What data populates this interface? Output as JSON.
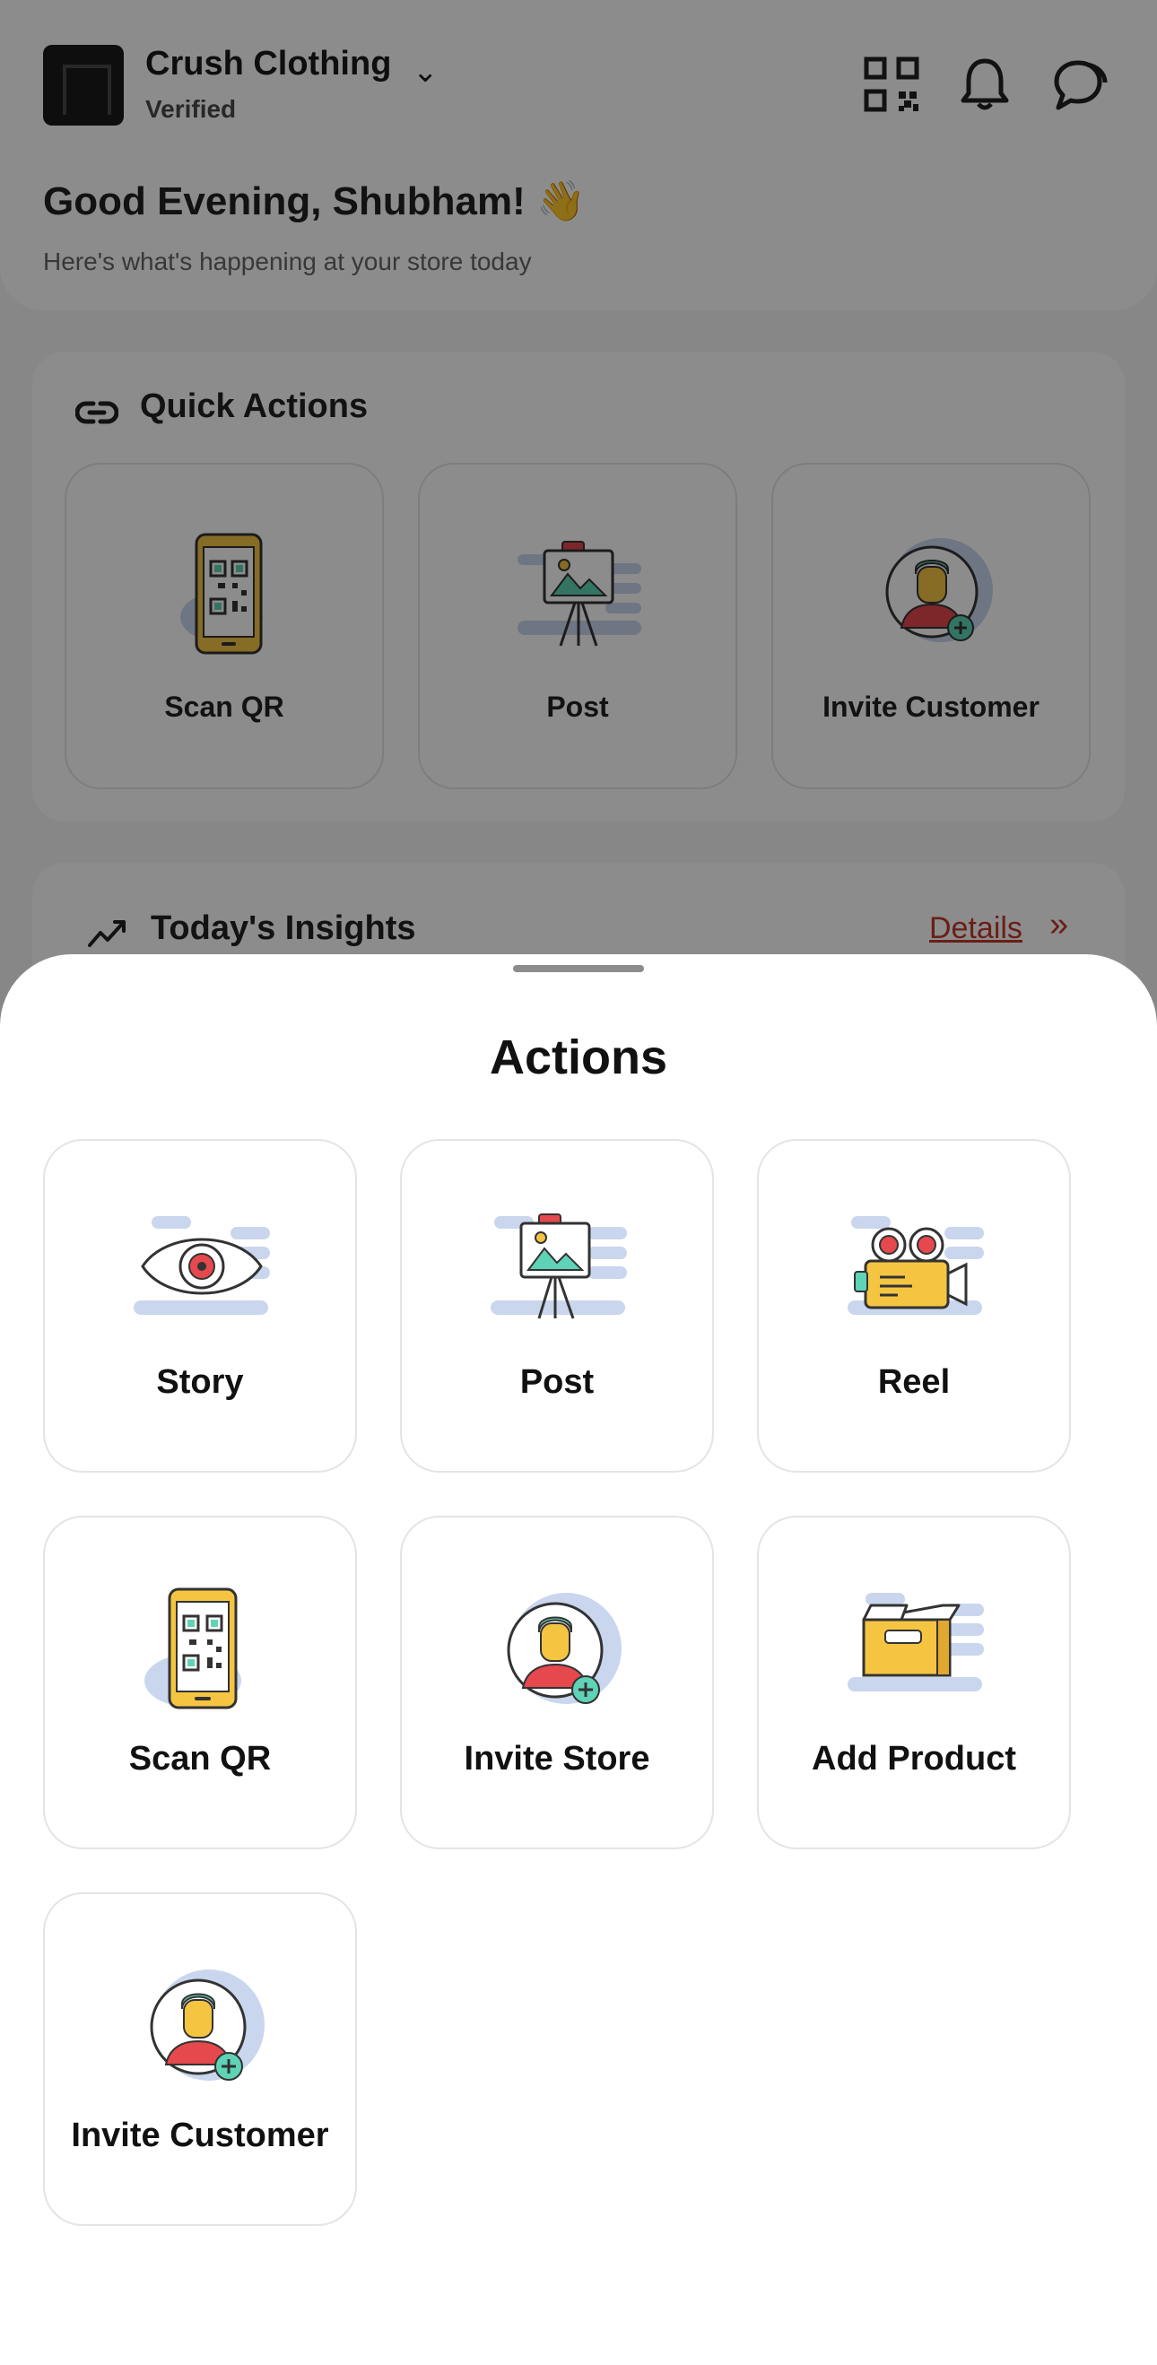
{
  "header": {
    "store_name": "Crush Clothing",
    "verified": "Verified",
    "greeting": "Good Evening, Shubham! 👋",
    "subtitle": "Here's what's happening at your store today",
    "icons": [
      "qr-icon",
      "bell-icon",
      "chat-icon",
      "chevron-down-icon"
    ]
  },
  "quick_actions": {
    "title": "Quick Actions",
    "items": [
      {
        "label": "Scan QR",
        "icon": "phone-qr-icon"
      },
      {
        "label": "Post",
        "icon": "easel-post-icon"
      },
      {
        "label": "Invite Customer",
        "icon": "person-add-icon"
      }
    ]
  },
  "insights": {
    "title": "Today's Insights",
    "details": "Details",
    "arrow": "»"
  },
  "sheet": {
    "title": "Actions",
    "items": [
      {
        "label": "Story",
        "icon": "eye-story-icon"
      },
      {
        "label": "Post",
        "icon": "easel-post-icon"
      },
      {
        "label": "Reel",
        "icon": "video-camera-icon"
      },
      {
        "label": "Scan QR",
        "icon": "phone-qr-icon"
      },
      {
        "label": "Invite Store",
        "icon": "person-add-icon"
      },
      {
        "label": "Add Product",
        "icon": "box-icon"
      },
      {
        "label": "Invite Customer",
        "icon": "person-add-icon"
      }
    ]
  },
  "colors": {
    "accent_red": "#c0392b",
    "icon_yellow": "#f5c542",
    "icon_teal": "#5fd3b5",
    "icon_red": "#e5484d",
    "icon_blue_soft": "#c9d6ee"
  }
}
